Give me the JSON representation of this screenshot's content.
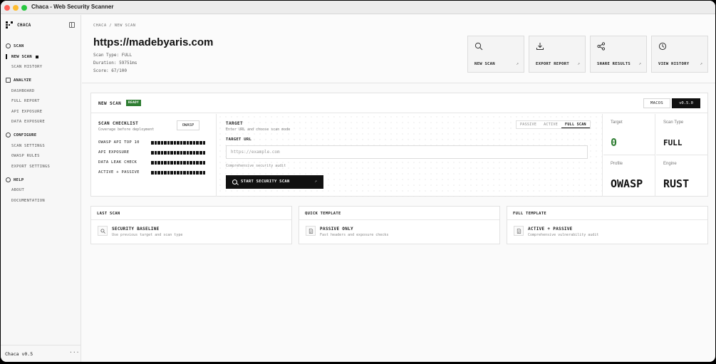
{
  "window": {
    "title": "Chaca - Web Security Scanner"
  },
  "sidebar": {
    "brand": "CHACA",
    "sections": [
      {
        "label": "SCAN",
        "icon": "target-icon"
      },
      {
        "label": "ANALYZE",
        "icon": "analyze-icon"
      },
      {
        "label": "CONFIGURE",
        "icon": "gear-icon"
      },
      {
        "label": "HELP",
        "icon": "help-icon"
      }
    ],
    "items": {
      "new_scan": "NEW SCAN",
      "scan_history": "SCAN HISTORY",
      "dashboard": "DASHBOARD",
      "full_report": "FULL REPORT",
      "api_exposure": "API EXPOSURE",
      "data_exposure": "DATA EXPOSURE",
      "scan_settings": "SCAN SETTINGS",
      "owasp_rules": "OWASP RULES",
      "export_settings": "EXPORT SETTINGS",
      "about": "ABOUT",
      "documentation": "DOCUMENTATION"
    },
    "footer": {
      "version": "Chaca v0.5",
      "more": "···"
    }
  },
  "header": {
    "breadcrumb": "CHACA / NEW SCAN",
    "url": "https://madebyaris.com",
    "scan_type": "Scan Type: FULL",
    "duration": "Duration: 59751ms",
    "score": "Score: 67/100",
    "actions": [
      {
        "label": "NEW SCAN",
        "icon": "search-icon"
      },
      {
        "label": "EXPORT REPORT",
        "icon": "download-icon"
      },
      {
        "label": "SHARE RESULTS",
        "icon": "share-icon"
      },
      {
        "label": "VIEW HISTORY",
        "icon": "clock-icon"
      }
    ],
    "action_arrow": "↗"
  },
  "panel": {
    "title": "NEW SCAN",
    "badge": "READY",
    "os": "MACOS",
    "version": "v0.5.0",
    "checklist": {
      "title": "SCAN CHECKLIST",
      "subtitle": "Coverage before deployment",
      "button": "OWASP",
      "rows": [
        {
          "label": "OWASP API TOP 10",
          "progress": 1.0
        },
        {
          "label": "API EXPOSURE",
          "progress": 1.0
        },
        {
          "label": "DATA LEAK CHECK",
          "progress": 1.0
        },
        {
          "label": "ACTIVE + PASSIVE",
          "progress": 1.0
        }
      ]
    },
    "target": {
      "title": "TARGET",
      "subtitle": "Enter URL and choose scan mode",
      "modes": [
        "PASSIVE",
        "ACTIVE",
        "FULL SCAN"
      ],
      "selected_mode": "FULL SCAN",
      "input_label": "TARGET URL",
      "input_placeholder": "https://example.com",
      "input_value": "",
      "hint": "Comprehensive security audit",
      "start_button": "START SECURITY SCAN",
      "start_arrow": "↗"
    },
    "stats": [
      {
        "label": "Target",
        "value": "0",
        "color": "#2e7d32"
      },
      {
        "label": "Scan Type",
        "value": "FULL"
      },
      {
        "label": "Profile",
        "value": "OWASP"
      },
      {
        "label": "Engine",
        "value": "RUST"
      }
    ]
  },
  "templates": [
    {
      "header": "LAST SCAN",
      "title": "SECURITY BASELINE",
      "subtitle": "Use previous target and scan type",
      "icon": "search-icon"
    },
    {
      "header": "QUICK TEMPLATE",
      "title": "PASSIVE ONLY",
      "subtitle": "Fast headers and exposure checks",
      "icon": "document-icon"
    },
    {
      "header": "FULL TEMPLATE",
      "title": "ACTIVE + PASSIVE",
      "subtitle": "Comprehensive vulnerability audit",
      "icon": "document-icon"
    }
  ],
  "colors": {
    "accent": "#111111",
    "ready": "#2e7d32",
    "close": "#ff5f57",
    "minimize": "#febc2e",
    "zoom": "#28c840"
  }
}
